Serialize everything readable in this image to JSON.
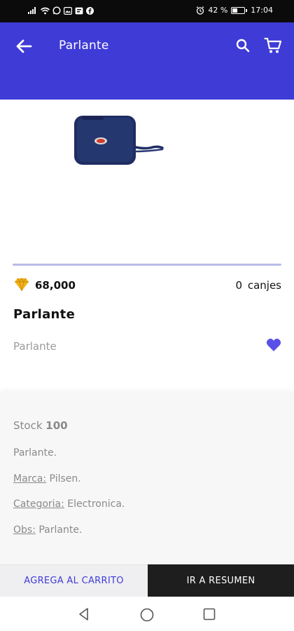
{
  "status_bar": {
    "battery": "42 %",
    "time": "17:04",
    "icons": [
      "signal-icon",
      "wifi-icon",
      "whatsapp-icon",
      "gallery-icon",
      "notification-icon",
      "facebook-icon",
      "alarm-icon",
      "battery-icon"
    ]
  },
  "app_bar": {
    "title": "Parlante",
    "icons": [
      "back-arrow-icon",
      "search-icon",
      "cart-icon"
    ],
    "color": "#3f3bd6"
  },
  "product": {
    "points": "68,000",
    "redeem_count": "0",
    "redeem_label": "canjes",
    "name": "Parlante",
    "subtitle": "Parlante",
    "image": "speaker-image",
    "favorite_color": "#5b50e6"
  },
  "details": {
    "stock_label": "Stock",
    "stock_value": "100",
    "description": "Parlante.",
    "brand_label": "Marca:",
    "brand_value": " Pilsen.",
    "category_label": "Categoria:",
    "category_value": " Electronica.",
    "obs_label": "Obs:",
    "obs_value": " Parlante."
  },
  "actions": {
    "add_to_cart": "AGREGA AL CARRITO",
    "go_to_summary": "IR A RESUMEN"
  },
  "nav_bar": {
    "icons": [
      "nav-back-icon",
      "nav-home-icon",
      "nav-recent-icon"
    ]
  }
}
